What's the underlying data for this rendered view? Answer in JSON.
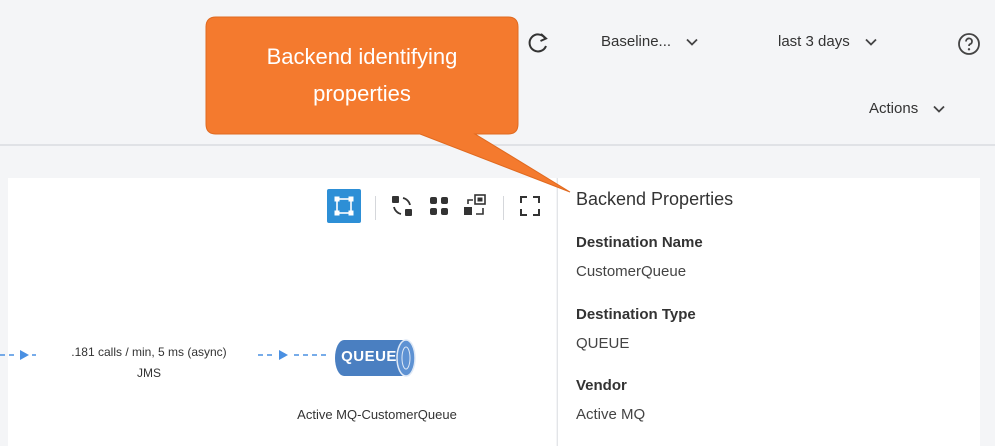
{
  "header": {
    "baseline_label": "Baseline...",
    "timerange_label": "last 3 days",
    "actions_label": "Actions"
  },
  "callout": {
    "line1": "Backend identifying",
    "line2": "properties"
  },
  "flow": {
    "edge_label": ".181 calls / min, 5 ms (async)",
    "edge_protocol": "JMS",
    "node_badge": "QUEUE",
    "node_name": "Active MQ-CustomerQueue"
  },
  "properties": {
    "title": "Backend Properties",
    "items": [
      {
        "label": "Destination Name",
        "value": "CustomerQueue"
      },
      {
        "label": "Destination Type",
        "value": "QUEUE"
      },
      {
        "label": "Vendor",
        "value": "Active MQ"
      }
    ]
  },
  "colors": {
    "accent": "#2d8fd6",
    "callout": "#f47a2e",
    "edge": "#4a90e2",
    "queue": "#4a7fc1"
  },
  "icons": [
    "refresh-icon",
    "chevron-down-icon",
    "help-icon",
    "select-mode-icon",
    "rotate-layout-icon",
    "grid-layout-icon",
    "arrange-icon",
    "fullscreen-icon",
    "arrow-icon"
  ]
}
